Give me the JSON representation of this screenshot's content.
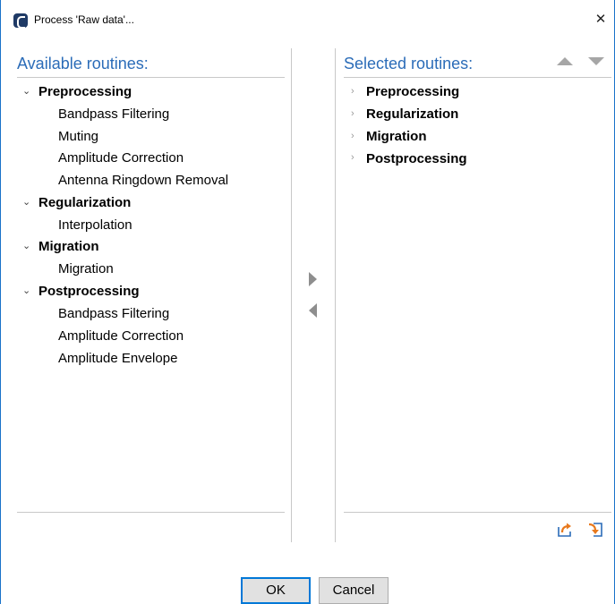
{
  "window": {
    "title": "Process 'Raw data'...",
    "close_glyph": "✕"
  },
  "available": {
    "heading": "Available routines:",
    "groups": [
      {
        "label": "Preprocessing",
        "expanded": true,
        "items": [
          "Bandpass Filtering",
          "Muting",
          "Amplitude Correction",
          "Antenna Ringdown Removal"
        ]
      },
      {
        "label": "Regularization",
        "expanded": true,
        "items": [
          "Interpolation"
        ]
      },
      {
        "label": "Migration",
        "expanded": true,
        "items": [
          "Migration"
        ]
      },
      {
        "label": "Postprocessing",
        "expanded": true,
        "items": [
          "Bandpass Filtering",
          "Amplitude Correction",
          "Amplitude Envelope"
        ]
      }
    ]
  },
  "selected": {
    "heading": "Selected routines:",
    "groups": [
      {
        "label": "Preprocessing",
        "expanded": false
      },
      {
        "label": "Regularization",
        "expanded": false
      },
      {
        "label": "Migration",
        "expanded": false
      },
      {
        "label": "Postprocessing",
        "expanded": false
      }
    ]
  },
  "icons": {
    "app": "app-logo-icon",
    "add": "arrow-right-icon",
    "remove": "arrow-left-icon",
    "move_up": "arrow-up-icon",
    "move_down": "arrow-down-icon",
    "export": "export-icon",
    "import": "import-icon",
    "export_color": "#e8791d",
    "import_color": "#e8791d"
  },
  "buttons": {
    "ok": "OK",
    "cancel": "Cancel"
  }
}
